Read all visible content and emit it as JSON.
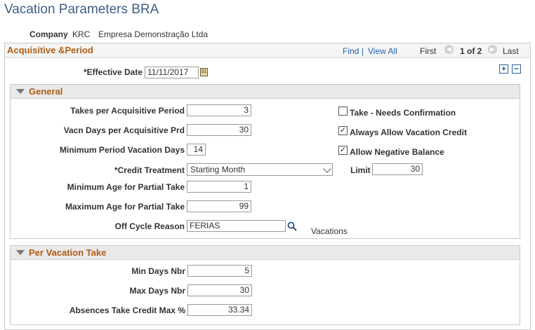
{
  "page": {
    "title": "Vacation Parameters BRA"
  },
  "company": {
    "label": "Company",
    "code": "KRC",
    "name": "Empresa Demonstração Ltda"
  },
  "acquisitive": {
    "title": "Acquisitive &Period",
    "nav": {
      "find": "Find",
      "separator": "|",
      "view_all": "View All",
      "first": "First",
      "counter": "1 of 2",
      "last": "Last"
    },
    "effective_date_label": "*Effective Date",
    "effective_date": "11/11/2017",
    "calendar_text": "31",
    "add_symbol": "+",
    "remove_symbol": "−"
  },
  "general": {
    "title": "General",
    "takes_label": "Takes per Acquisitive Period",
    "takes": "3",
    "vacn_days_label": "Vacn Days per Acquisitive Prd",
    "vacn_days": "30",
    "min_period_label": "Minimum Period Vacation Days",
    "min_period": "14",
    "credit_treatment_label": "*Credit Treatment",
    "credit_treatment": "Starting Month",
    "limit_label": "Limit",
    "limit": "30",
    "min_age_label": "Minimum Age for Partial Take",
    "min_age": "1",
    "max_age_label": "Maximum Age for Partial Take",
    "max_age": "99",
    "off_cycle_label": "Off Cycle Reason",
    "off_cycle": "FERIAS",
    "off_cycle_desc": "Vacations",
    "take_needs_conf_label": "Take - Needs Confirmation",
    "take_needs_conf_checked": false,
    "always_allow_label": "Always Allow Vacation Credit",
    "always_allow_checked": true,
    "allow_negative_label": "Allow Negative Balance",
    "allow_negative_checked": true,
    "check_mark": "✓"
  },
  "per_vacation": {
    "title": "Per Vacation Take",
    "min_days_label": "Min Days Nbr",
    "min_days": "5",
    "max_days_label": "Max Days Nbr",
    "max_days": "30",
    "absences_label": "Absences Take Credit Max %",
    "absences": "33.34"
  },
  "colors": {
    "title_blue": "#3f5f86",
    "section_orange": "#b05c14",
    "link_blue": "#2463a8"
  },
  "icons": {
    "calendar": "calendar-icon",
    "lookup": "magnifier-icon",
    "collapse": "triangle-down-icon",
    "prev": "chevron-left-icon",
    "next": "chevron-right-icon"
  }
}
